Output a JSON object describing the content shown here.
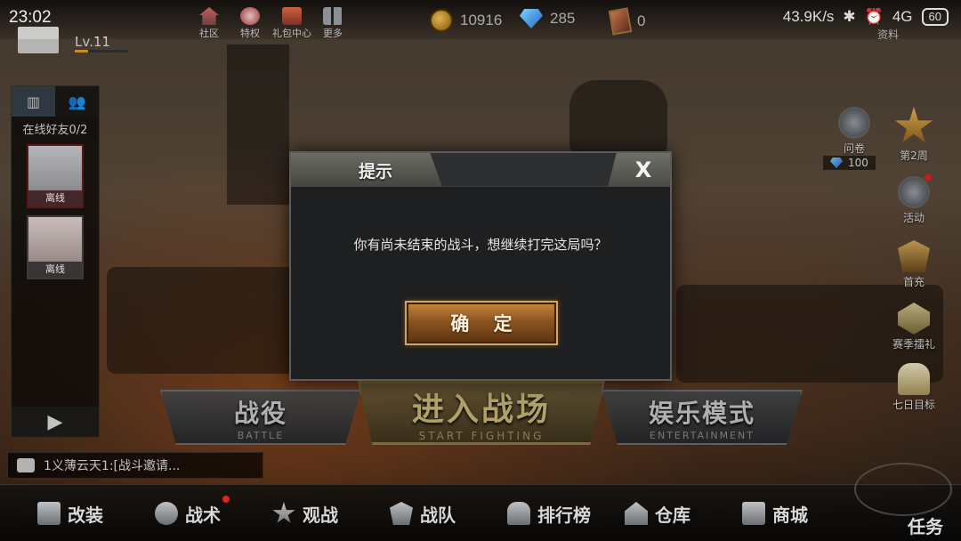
{
  "status_bar": {
    "time": "23:02",
    "network_speed": "43.9K/s",
    "signal": "4G",
    "battery": "60"
  },
  "player": {
    "level": "Lv.11",
    "level_progress": 0.25
  },
  "top_nav": [
    {
      "label": "社区",
      "icon": "home-icon"
    },
    {
      "label": "特权",
      "icon": "vip-character-icon"
    },
    {
      "label": "礼包中心",
      "icon": "gift-icon"
    },
    {
      "label": "更多",
      "icon": "grid-icon"
    }
  ],
  "currencies": {
    "coins": "10916",
    "diamonds": "285",
    "cards": "0"
  },
  "top_right_label": "资料",
  "friends_panel": {
    "title": "在线好友0/2",
    "friend1_status": "离线",
    "friend2_status": "离线",
    "expand_symbol": "▶"
  },
  "side_menu": {
    "survey": "问卷",
    "survey_reward": "100",
    "week": "第2周",
    "activity": "活动",
    "first_charge": "首充",
    "season_gift": "赛季擂礼",
    "seven_day": "七日目标"
  },
  "modes": {
    "campaign": "战役",
    "campaign_sub": "BATTLE",
    "enter_battle": "进入战场",
    "enter_battle_sub": "START FIGHTING",
    "entertainment": "娱乐模式",
    "entertainment_sub": "ENTERTAINMENT"
  },
  "chat": {
    "message": "1义薄云天1:[战斗邀请..."
  },
  "bottom_bar": [
    {
      "label": "改装",
      "icon": "wrench-tank-icon"
    },
    {
      "label": "战术",
      "icon": "gasmask-icon"
    },
    {
      "label": "观战",
      "icon": "star-icon"
    },
    {
      "label": "战队",
      "icon": "team-shield-icon"
    },
    {
      "label": "排行榜",
      "icon": "trophy-icon"
    },
    {
      "label": "仓库",
      "icon": "warehouse-icon"
    },
    {
      "label": "商城",
      "icon": "shop-icon"
    }
  ],
  "task_label": "任务",
  "dialog": {
    "title": "提示",
    "close": "X",
    "message": "你有尚未结束的战斗，想继续打完这局吗？",
    "confirm": "确 定"
  },
  "colors": {
    "accent_gold": "#c9b879",
    "confirm_orange": "#c7873f",
    "notify_red": "#e02020"
  }
}
